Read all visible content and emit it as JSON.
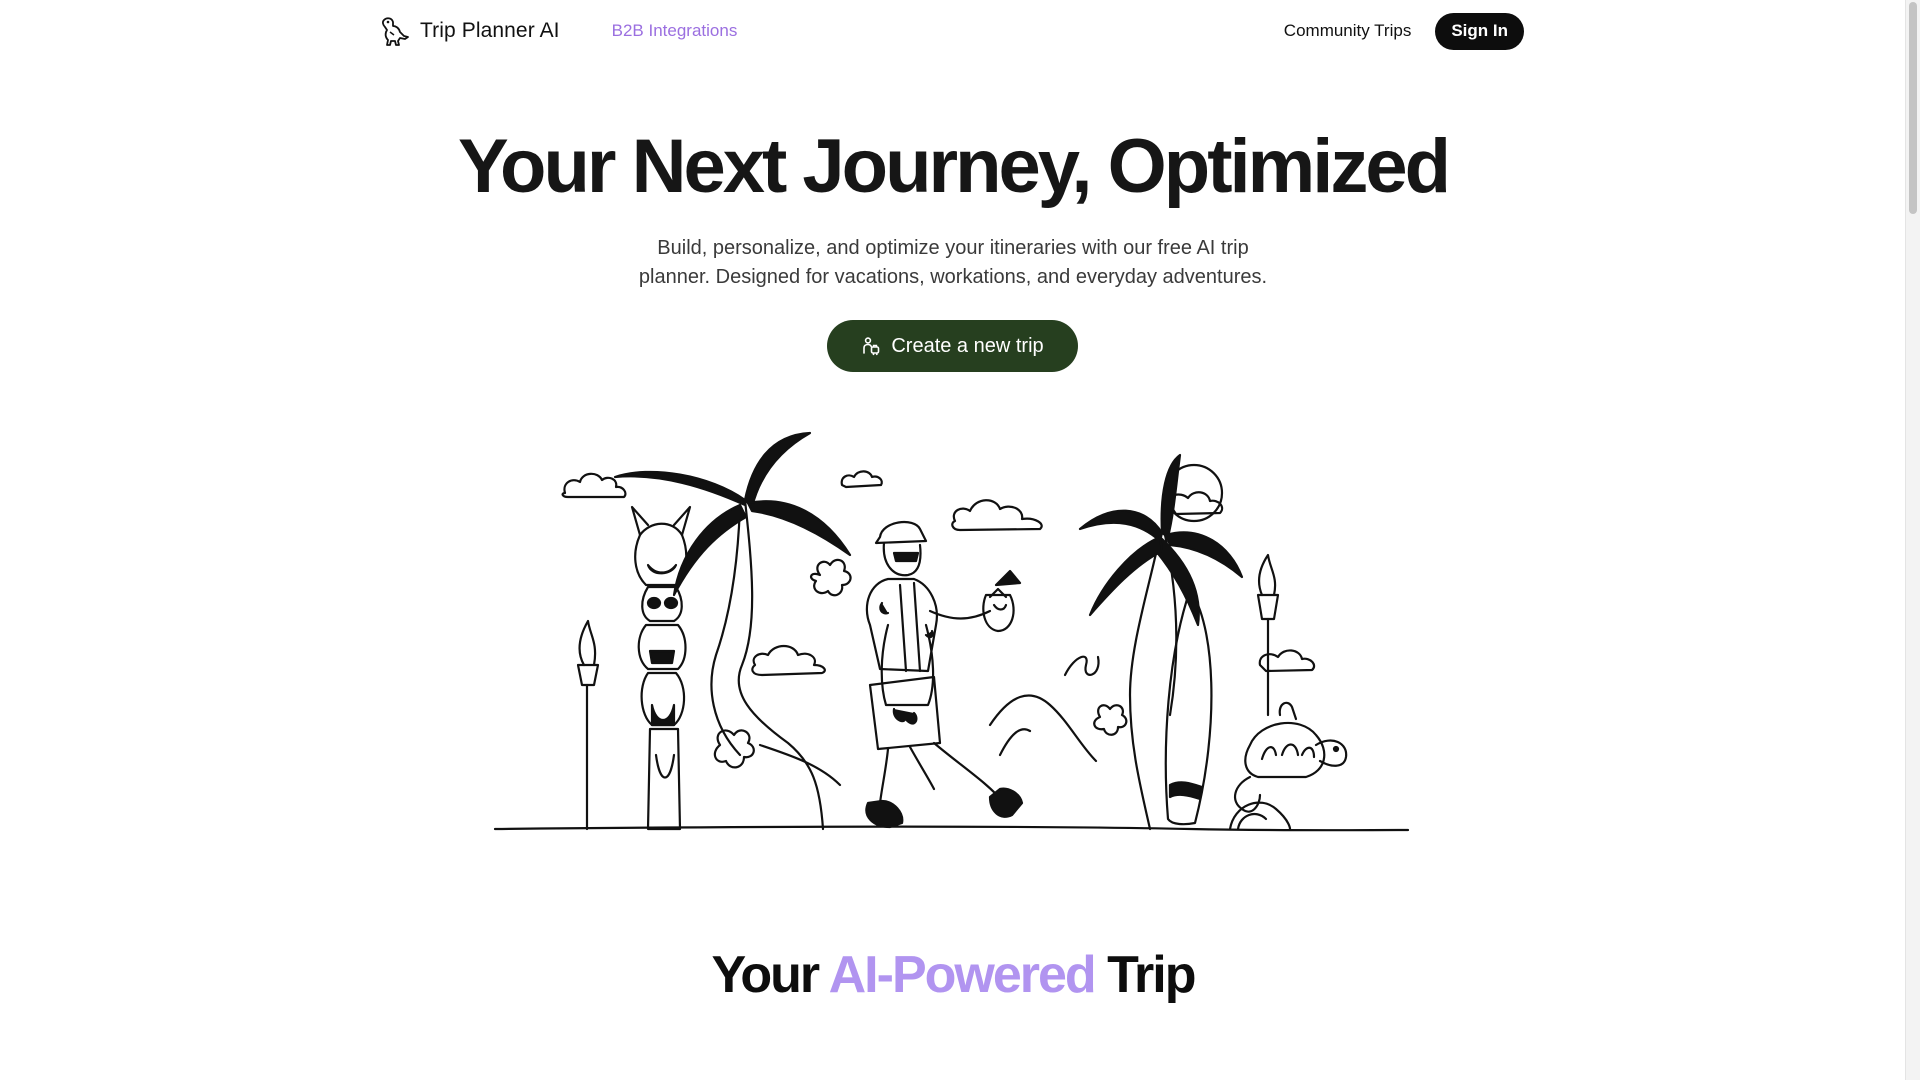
{
  "header": {
    "brand_name": "Trip Planner AI",
    "brand_icon": "dinosaur-logo-icon",
    "nav_b2b": "B2B Integrations",
    "nav_community": "Community Trips",
    "signin_label": "Sign In"
  },
  "hero": {
    "title": "Your Next Journey, Optimized",
    "subtitle_line1": "Build, personalize, and optimize your itineraries with our free AI trip",
    "subtitle_line2": "planner. Designed for vacations, workations, and everyday adventures.",
    "cta_label": "Create a new trip",
    "cta_icon": "traveler-icon"
  },
  "illustration": {
    "subject": "tropical-traveler-illustration"
  },
  "section": {
    "title_prefix": "Your",
    "title_accent": "AI-Powered",
    "title_suffix": "Trip"
  },
  "colors": {
    "accent_purple": "#9b6fe0",
    "heading_accent": "#b194f0",
    "cta_green": "#263f1f",
    "signin_black": "#0d0d0d"
  }
}
